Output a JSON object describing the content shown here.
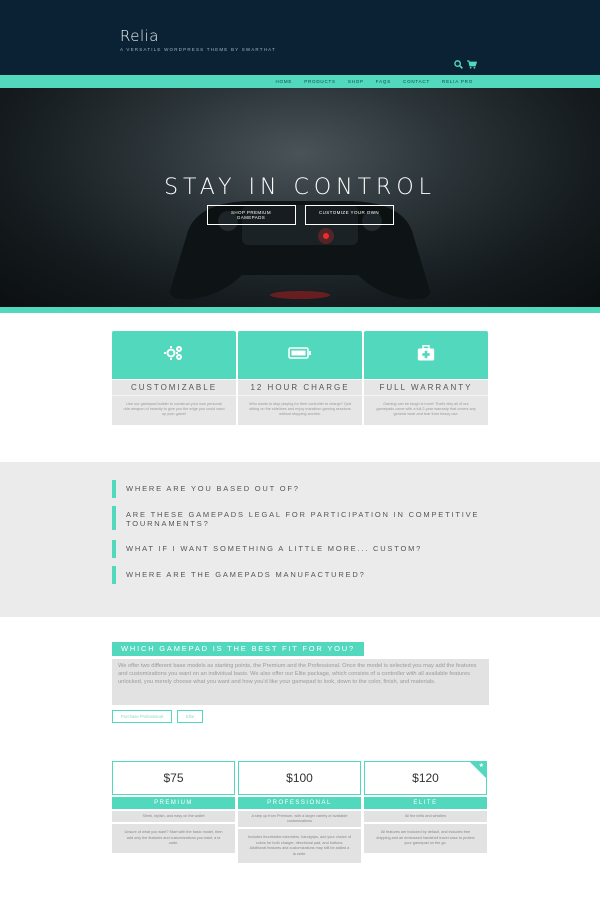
{
  "header": {
    "logo": "Relia",
    "tagline": "A versatile WordPress theme by Swarthat"
  },
  "icons": {
    "search": "search-icon",
    "cart": "cart-icon"
  },
  "nav": {
    "items": [
      "Home",
      "Products",
      "Shop",
      "FAQs",
      "Contact",
      "Relia Pro"
    ]
  },
  "hero": {
    "title": "STAY IN CONTROL",
    "button_1": "Shop Premium Gamepads",
    "button_2": "Customize your own"
  },
  "features": [
    {
      "icon": "gears-icon",
      "title": "Customizable",
      "desc": "Use our gamepad builder to construct your own personal ride-weapon of insanity to give you the edge you could used up your game!"
    },
    {
      "icon": "battery-icon",
      "title": "12 Hour Charge",
      "desc": "Who wants to stop playing for their controller to charge? Quit sitting on the sidelines and enjoy marathon gaming sessions without stopping worries."
    },
    {
      "icon": "first-aid-icon",
      "title": "Full Warranty",
      "desc": "Gaming can be tough is more! That's why all of our gamepads come with a full 2-year warranty that covers any general wear and tear from heavy use."
    }
  ],
  "faq": [
    "Where are you based out of?",
    "Are these gamepads legal for participation in competitive tournaments?",
    "What if I want something a little more... custom?",
    "Where are the gamepads manufactured?"
  ],
  "which": {
    "heading": "Which gamepad is the best fit for you?",
    "body": "We offer two different base models as starting points, the Premium and the Professional. Once the model is selected you may add the features and customizations you want on an individual basis. We also offer our Elite package, which consists of a controller with all available features unlocked, you merely choose what you want and how you'd like your gamepad to look, down to the color, finish, and materials.",
    "link_1": "Purchase Professional",
    "link_2": "Elite"
  },
  "pricing": [
    {
      "price": "$75",
      "name": "Premium",
      "tag": "Sleek, stylish, and easy on the wallet",
      "features": "Unsure of what you want? Start with the basic model, then add only the features and customizations you want, a la carte."
    },
    {
      "price": "$100",
      "name": "Professional",
      "tag": "A step up from Premium, with a larger variety of available customizations",
      "features": "Includes thumbstick extenders, handgrips, and your choice of colors for both charger, directional pad, and buttons. Additional features and customizations may still be added a la carte."
    },
    {
      "price": "$120",
      "name": "Elite",
      "tag": "All the bells and whistles",
      "features": "All features are included by default, and includes free shipping and an embossed hardshell travel case to protect your gamepad on the go."
    }
  ],
  "colors": {
    "accent": "#52d8bd",
    "header": "#0a2233"
  }
}
